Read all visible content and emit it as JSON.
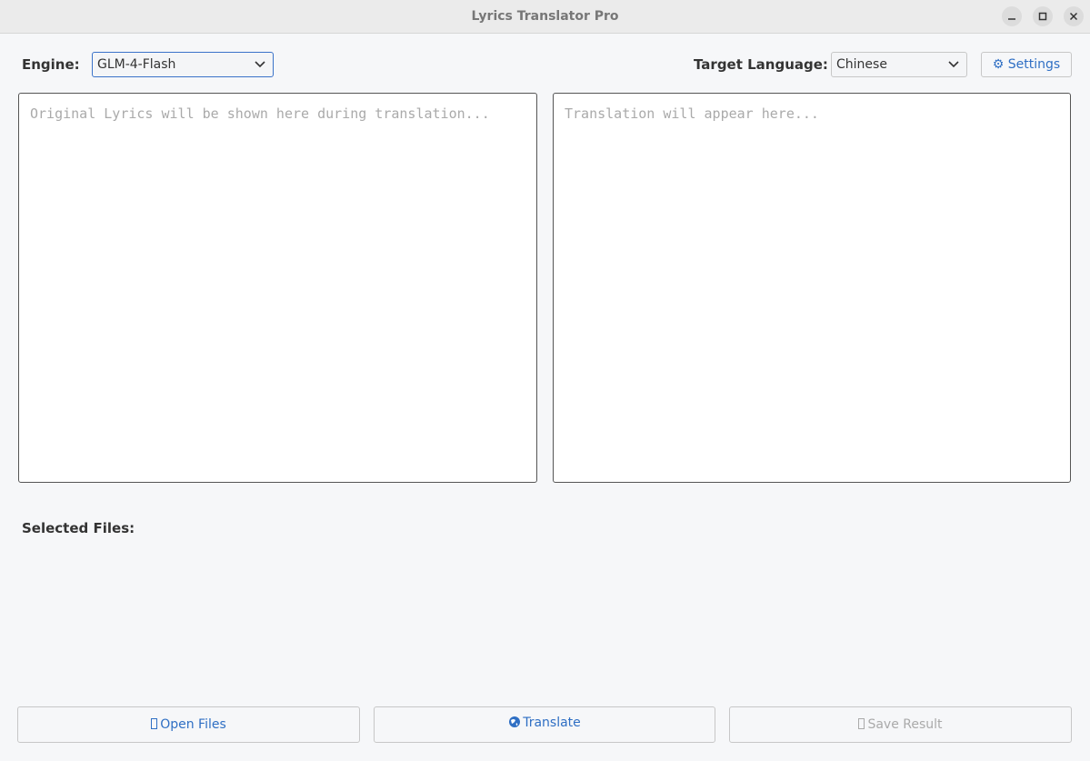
{
  "window": {
    "title": "Lyrics Translator Pro"
  },
  "engine": {
    "label": "Engine:",
    "value": "GLM-4-Flash"
  },
  "target_language": {
    "label": "Target Language:",
    "value": "Chinese"
  },
  "settings": {
    "label": "⚙ Settings"
  },
  "original": {
    "placeholder": "Original Lyrics will be shown here during translation..."
  },
  "translation": {
    "placeholder": "Translation will appear here..."
  },
  "selected_files": {
    "label": "Selected Files:"
  },
  "actions": {
    "open_files": "Open Files",
    "translate": "Translate",
    "save_result": "Save Result"
  },
  "colors": {
    "accent": "#2f6fc4",
    "focus_border": "#3b73c9",
    "disabled_text": "#aaaaaa"
  }
}
